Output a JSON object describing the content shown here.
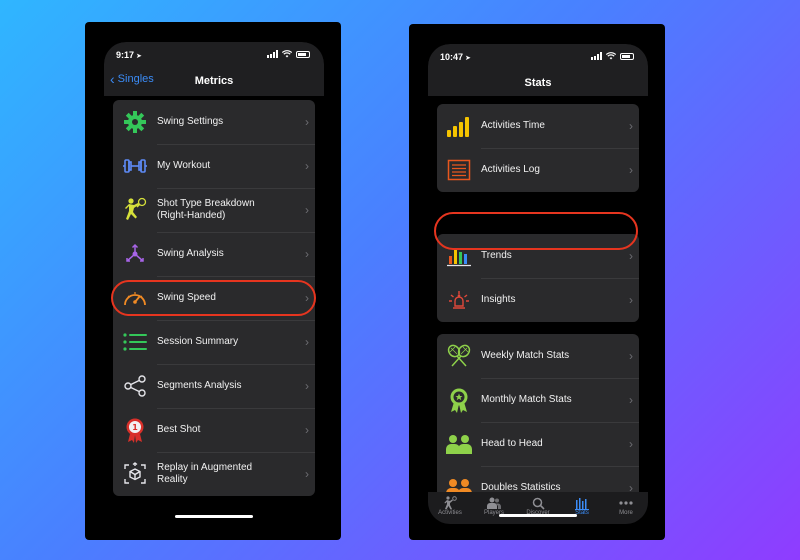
{
  "left_phone": {
    "status_time": "9:17",
    "back_label": "Singles",
    "title": "Metrics",
    "items": [
      {
        "label": "Swing Settings",
        "icon": "gear-icon"
      },
      {
        "label": "My Workout",
        "icon": "dumbbell-icon"
      },
      {
        "label": "Shot Type Breakdown (Right-Handed)",
        "icon": "player-icon"
      },
      {
        "label": "Swing Analysis",
        "icon": "analysis-icon"
      },
      {
        "label": "Swing Speed",
        "icon": "speedometer-icon"
      },
      {
        "label": "Session Summary",
        "icon": "list-icon"
      },
      {
        "label": "Segments Analysis",
        "icon": "share-nodes-icon"
      },
      {
        "label": "Best Shot",
        "icon": "medal-icon"
      },
      {
        "label": "Replay in Augmented Reality",
        "icon": "ar-cube-icon"
      }
    ],
    "highlighted": "Swing Speed"
  },
  "right_phone": {
    "status_time": "10:47",
    "title": "Stats",
    "group1": [
      {
        "label": "Activities Time",
        "icon": "bar-chart-icon"
      },
      {
        "label": "Activities Log",
        "icon": "log-icon"
      }
    ],
    "group2": [
      {
        "label": "Trends",
        "icon": "trends-icon"
      },
      {
        "label": "Insights",
        "icon": "insights-icon"
      }
    ],
    "group3": [
      {
        "label": "Weekly Match Stats",
        "icon": "rackets-icon"
      },
      {
        "label": "Monthly Match Stats",
        "icon": "award-icon"
      },
      {
        "label": "Head to Head",
        "icon": "head-to-head-icon"
      },
      {
        "label": "Doubles Statistics",
        "icon": "doubles-icon"
      }
    ],
    "highlighted": "Trends",
    "tabs": [
      {
        "label": "Activities",
        "icon": "activities-icon"
      },
      {
        "label": "Players",
        "icon": "players-icon"
      },
      {
        "label": "Discover",
        "icon": "search-icon"
      },
      {
        "label": "Stats",
        "icon": "stats-icon",
        "active": true
      },
      {
        "label": "More",
        "icon": "more-icon"
      }
    ]
  },
  "colors": {
    "accent_blue": "#3b8cf7",
    "highlight_red": "#e6351f",
    "row_bg": "#2a2a2c"
  }
}
